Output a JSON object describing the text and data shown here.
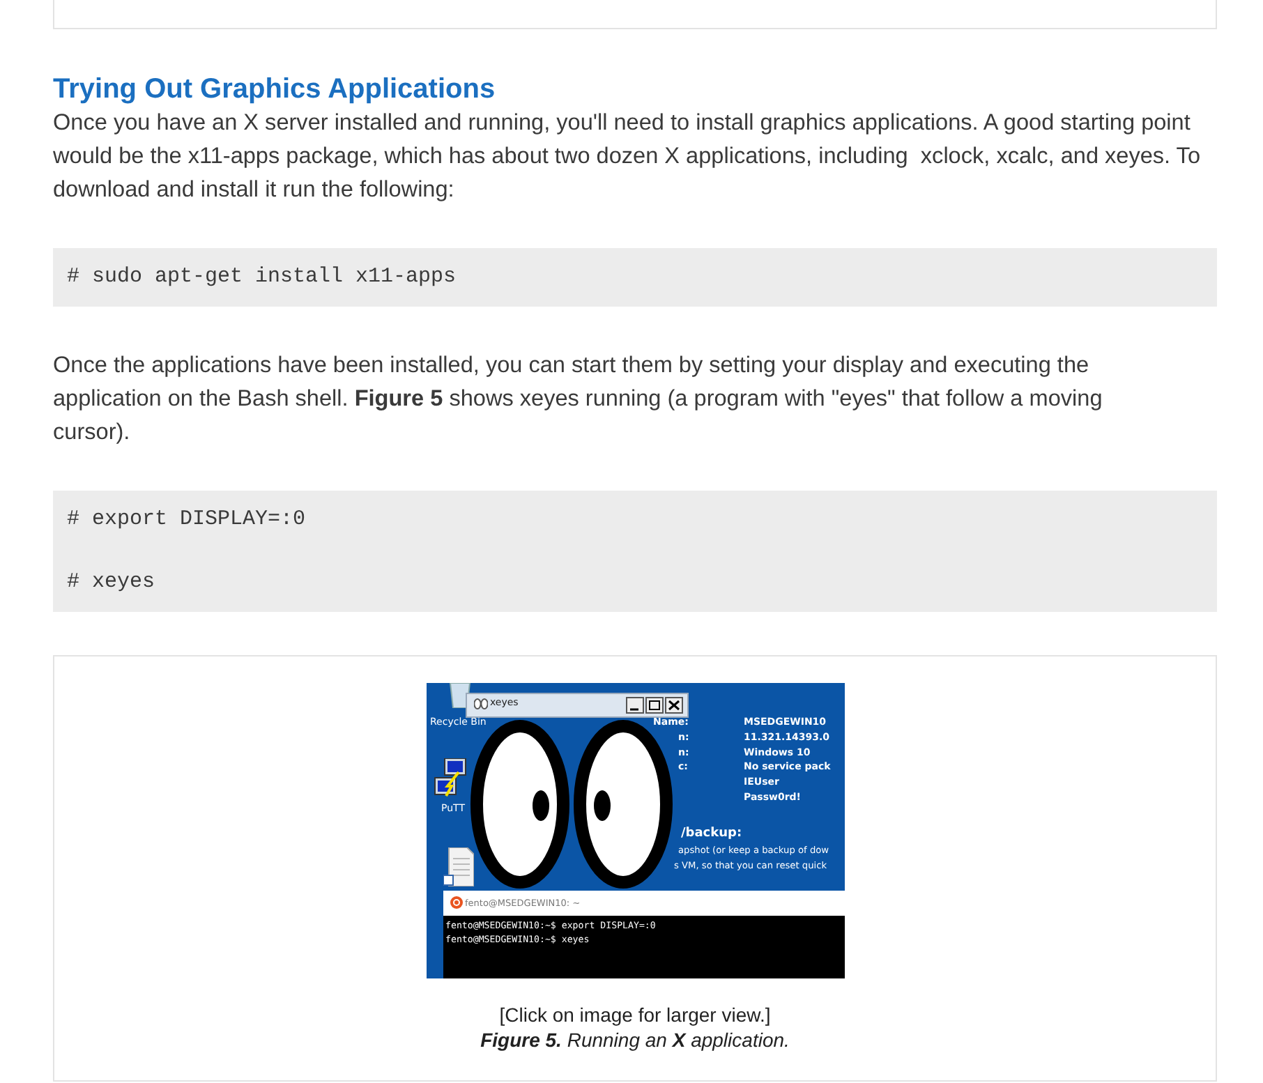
{
  "heading": "Trying Out Graphics Applications",
  "intro": "Once you have an X server installed and running, you'll need to install graphics applications. A good starting point would be the x11-apps package, which has about two dozen X applications, including  xclock, xcalc, and xeyes. To download and install it run the following:",
  "code_blocks": [
    {
      "lines": [
        "# sudo apt-get install x11-apps"
      ]
    },
    {
      "lines": [
        "# export DISPLAY=:0",
        "# xeyes"
      ]
    }
  ],
  "paragraphs": [
    "Once the applications have been installed, you can start them by setting your display and executing the application on the Bash shell. **Figure 5** shows xeyes running (a program with \"eyes\" that follow a moving cursor)."
  ],
  "figure": {
    "screenshot": {
      "desktop_icons": [
        {
          "kind": "recycle-bin",
          "label": "Recycle Bin"
        },
        {
          "kind": "putty",
          "label": "PuTT"
        },
        {
          "kind": "document"
        }
      ],
      "xeyes_window": {
        "title": "xeyes"
      },
      "info": {
        "labels": [
          "Name:",
          "n:",
          "n:",
          "c:"
        ],
        "values": [
          "MSEDGEWIN10",
          "11.321.14393.0",
          "Windows 10",
          "No service pack",
          "IEUser",
          "Passw0rd!"
        ]
      },
      "backup": {
        "heading": "/backup:",
        "lines": [
          "apshot (or keep a backup of dow",
          "s VM, so that you can reset quick"
        ]
      },
      "terminal": {
        "title": "fento@MSEDGEWIN10: ~",
        "lines": [
          "fento@MSEDGEWIN10:~$ export DISPLAY=:0",
          "fento@MSEDGEWIN10:~$ xeyes"
        ]
      }
    },
    "note": "[Click on image for larger view.]",
    "caption": "**Figure 5.** Running an **X** application."
  }
}
